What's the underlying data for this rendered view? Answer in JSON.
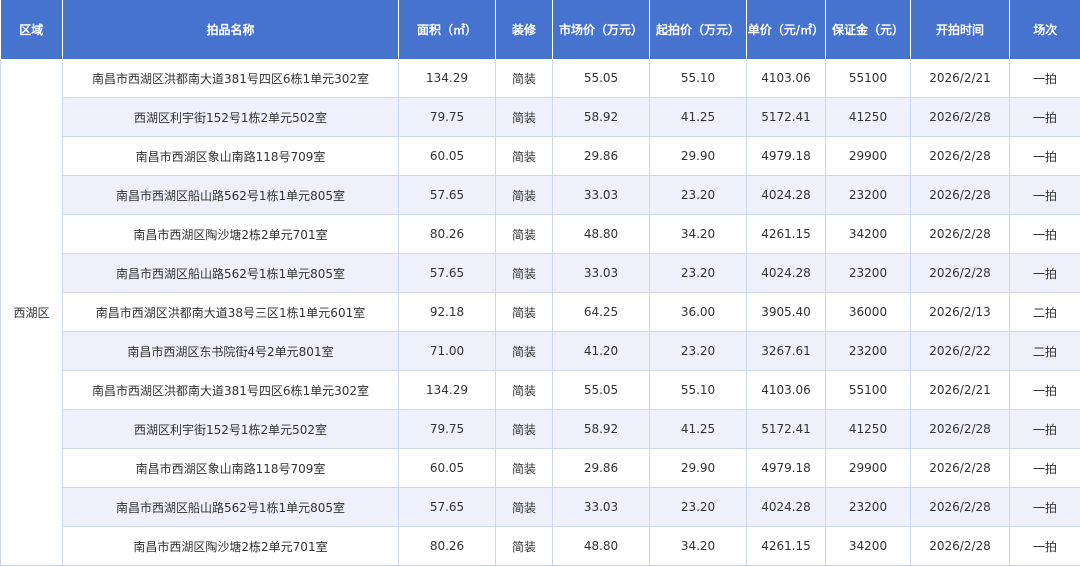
{
  "columns": [
    "区域",
    "拍品名称",
    "面积（㎡）",
    "装修",
    "市场价（万元）",
    "起拍价（万元）",
    "单价（元/㎡）",
    "保证金（元）",
    "开拍时间",
    "场次"
  ],
  "region": "西湖区",
  "rows": [
    [
      "南昌市西湖区洪都南大道381号四区6栋1单元302室",
      "134.29",
      "简装",
      "55.05",
      "55.10",
      "4103.06",
      "55100",
      "2026/2/21",
      "一拍"
    ],
    [
      "西湖区利宇街152号1栋2单元502室",
      "79.75",
      "简装",
      "58.92",
      "41.25",
      "5172.41",
      "41250",
      "2026/2/28",
      "一拍"
    ],
    [
      "南昌市西湖区象山南路118号709室",
      "60.05",
      "简装",
      "29.86",
      "29.90",
      "4979.18",
      "29900",
      "2026/2/28",
      "一拍"
    ],
    [
      "南昌市西湖区船山路562号1栋1单元805室",
      "57.65",
      "简装",
      "33.03",
      "23.20",
      "4024.28",
      "23200",
      "2026/2/28",
      "一拍"
    ],
    [
      "南昌市西湖区陶沙塘2栋2单元701室",
      "80.26",
      "简装",
      "48.80",
      "34.20",
      "4261.15",
      "34200",
      "2026/2/28",
      "一拍"
    ],
    [
      "南昌市西湖区船山路562号1栋1单元805室",
      "57.65",
      "简装",
      "33.03",
      "23.20",
      "4024.28",
      "23200",
      "2026/2/28",
      "一拍"
    ],
    [
      "南昌市西湖区洪都南大道38号三区1栋1单元601室",
      "92.18",
      "简装",
      "64.25",
      "36.00",
      "3905.40",
      "36000",
      "2026/2/13",
      "二拍"
    ],
    [
      "南昌市西湖区东书院街4号2单元801室",
      "71.00",
      "简装",
      "41.20",
      "23.20",
      "3267.61",
      "23200",
      "2026/2/22",
      "二拍"
    ],
    [
      "南昌市西湖区洪都南大道381号四区6栋1单元302室",
      "134.29",
      "简装",
      "55.05",
      "55.10",
      "4103.06",
      "55100",
      "2026/2/21",
      "一拍"
    ],
    [
      "西湖区利宇街152号1栋2单元502室",
      "79.75",
      "简装",
      "58.92",
      "41.25",
      "5172.41",
      "41250",
      "2026/2/28",
      "一拍"
    ],
    [
      "南昌市西湖区象山南路118号709室",
      "60.05",
      "简装",
      "29.86",
      "29.90",
      "4979.18",
      "29900",
      "2026/2/28",
      "一拍"
    ],
    [
      "南昌市西湖区船山路562号1栋1单元805室",
      "57.65",
      "简装",
      "33.03",
      "23.20",
      "4024.28",
      "23200",
      "2026/2/28",
      "一拍"
    ],
    [
      "南昌市西湖区陶沙塘2栋2单元701室",
      "80.26",
      "简装",
      "48.80",
      "34.20",
      "4261.15",
      "34200",
      "2026/2/28",
      "一拍"
    ]
  ]
}
